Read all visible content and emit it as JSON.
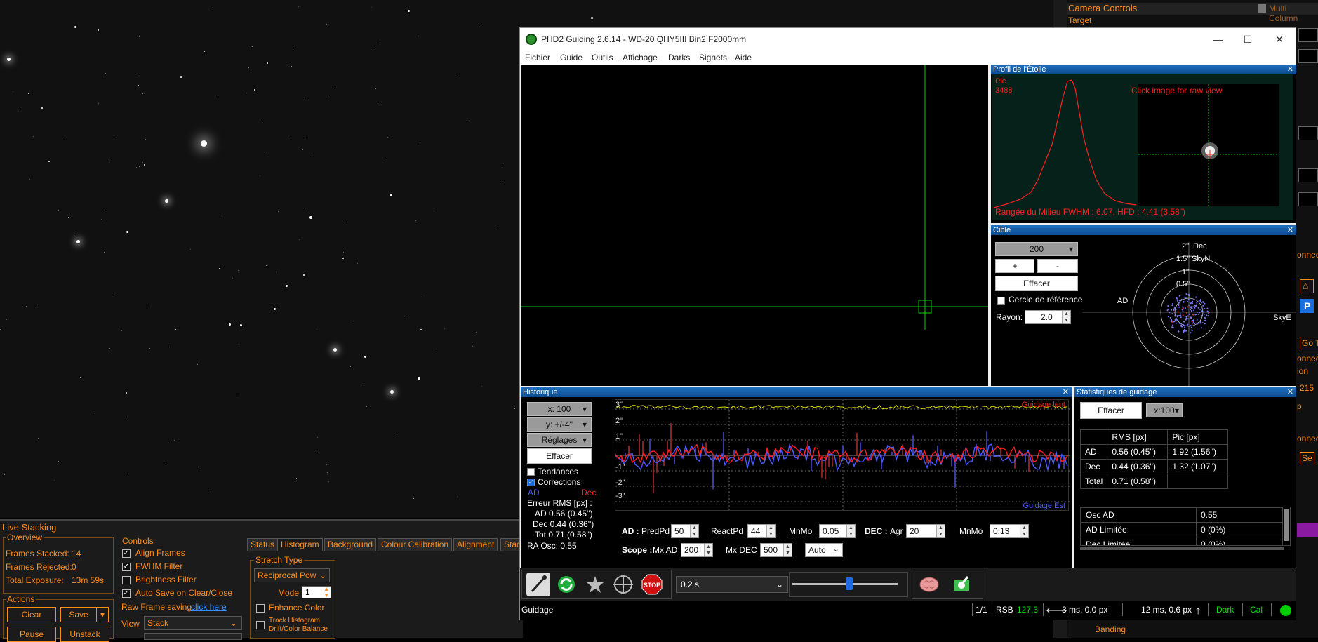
{
  "bg_app": {
    "camera_controls_title": "Camera Controls",
    "multi_column": "Multi Column",
    "target_label": "Target",
    "right_texts": [
      "onnect",
      "Go T",
      "onnect",
      "ion",
      "215",
      "p",
      "onnect",
      "Se"
    ],
    "banding_label": "Banding"
  },
  "live_stacking": {
    "title": "Live Stacking",
    "overview": {
      "label": "Overview",
      "frames_stacked_label": "Frames Stacked:",
      "frames_stacked": "14",
      "frames_rejected_label": "Frames Rejected:",
      "frames_rejected": "0",
      "total_exposure_label": "Total Exposure:",
      "total_exposure": "13m 59s"
    },
    "actions": {
      "label": "Actions",
      "clear": "Clear",
      "save": "Save",
      "pause": "Pause",
      "unstack": "Unstack"
    },
    "controls": {
      "label": "Controls",
      "align_frames": "Align Frames",
      "fwhm_filter": "FWHM Filter",
      "brightness_filter": "Brightness Filter",
      "auto_save": "Auto Save on Clear/Close",
      "raw_frame_saving": "Raw Frame saving",
      "click_here": "click here",
      "view_label": "View",
      "view_value": "Stack"
    },
    "tabs": [
      "Status",
      "Histogram",
      "Background",
      "Colour Calibration",
      "Alignment",
      "Stac"
    ],
    "active_tab": "Histogram",
    "stretch": {
      "label": "Stretch Type",
      "value": "Reciprocal Pow",
      "mode_label": "Mode",
      "mode_value": "1",
      "enhance_color": "Enhance Color",
      "track_histogram": "Track Histogram",
      "drift_balance": "Drift/Color Balance"
    }
  },
  "phd": {
    "title": "PHD2 Guiding 2.6.14 - WD-20 QHY5III Bin2 F2000mm",
    "menu": [
      "Fichier",
      "Guide",
      "Outils",
      "Affichage",
      "Darks",
      "Signets",
      "Aide"
    ],
    "star_profile": {
      "title": "Profil de l'Étoile",
      "peak_label": "Pic",
      "peak_value": "3488",
      "click_hint": "Click image for raw view",
      "fwhm_line": "Rangée du Milieu FWHM : 6.07, HFD : 4.41 (3.58\")"
    },
    "target": {
      "title": "Cible",
      "scale_value": "200",
      "plus": "+",
      "minus": "-",
      "clear": "Effacer",
      "ref_circle": "Cercle de référence",
      "radius_label": "Rayon:",
      "radius_value": "2.0",
      "labels": {
        "dec": "Dec",
        "skyn": "SkyN",
        "ad": "AD",
        "skye": "SkyE",
        "r2": "2\"",
        "r15": "1.5\"",
        "r1": "1\"",
        "r05": "0.5\""
      }
    },
    "history": {
      "title": "Historique",
      "x_scale": "x: 100",
      "y_scale": "y: +/-4''",
      "settings": "Réglages",
      "clear": "Effacer",
      "trends": "Tendances",
      "corrections": "Corrections",
      "ad_label": "AD",
      "dec_label": "Dec",
      "rms_title": "Erreur RMS [px] :",
      "rms_ad": "AD  0.56 (0.45'')",
      "rms_dec": "Dec  0.44 (0.36'')",
      "rms_tot": "Tot  0.71 (0.58'')",
      "ra_osc": "RA Osc: 0.55",
      "y_ticks": [
        "3\"",
        "2\"",
        "1\"",
        "-1\"",
        "-2\"",
        "-3\""
      ],
      "graph_label_top": "Guidage lent",
      "graph_label_bottom": "Guidage Est",
      "params": {
        "ad_label": "AD :",
        "predpd_label": "PredPd",
        "predpd": "50",
        "reactpd_label": "ReactPd",
        "reactpd": "44",
        "mnmo_label": "MnMo",
        "mnmo_ad": "0.05",
        "dec_label": "DEC :",
        "agr_label": "Agr",
        "agr": "20",
        "mnmo_dec": "0.13",
        "scope_label": "Scope :",
        "mxad_label": "Mx AD",
        "mxad": "200",
        "mxdec_label": "Mx DEC",
        "mxdec": "500",
        "dec_mode": "Auto"
      }
    },
    "stats": {
      "title": "Statistiques de guidage",
      "clear": "Effacer",
      "scale": "x:100",
      "headers": [
        "",
        "RMS [px]",
        "Pic [px]"
      ],
      "rows": [
        [
          "AD",
          "0.56 (0.45'')",
          "1.92 (1.56'')"
        ],
        [
          "Dec",
          "0.44 (0.36'')",
          "1.32 (1.07'')"
        ],
        [
          "Total",
          "0.71 (0.58'')",
          ""
        ]
      ],
      "rows2": [
        [
          "Osc AD",
          "0.55"
        ],
        [
          "AD Limitée",
          "0 (0%)"
        ],
        [
          "Dec Limitée",
          "0 (0%)"
        ]
      ]
    },
    "toolbar": {
      "exposure": "0.2 s",
      "stop": "STOP"
    },
    "statusbar": {
      "state": "Guidage",
      "frame": "1/1",
      "snr_label": "RSB",
      "snr": "127.3",
      "ra_pulse": "3 ms, 0.0 px",
      "dec_pulse": "12 ms, 0.6 px",
      "dark": "Dark",
      "cal": "Cal"
    }
  },
  "colors": {
    "ra": "#4a5cff",
    "dec": "#ff2020",
    "accent_orange": "#ff8c1a",
    "lock_green": "#00d000",
    "snr_green": "#00e000",
    "pane_blue": "#1f6fc0"
  }
}
